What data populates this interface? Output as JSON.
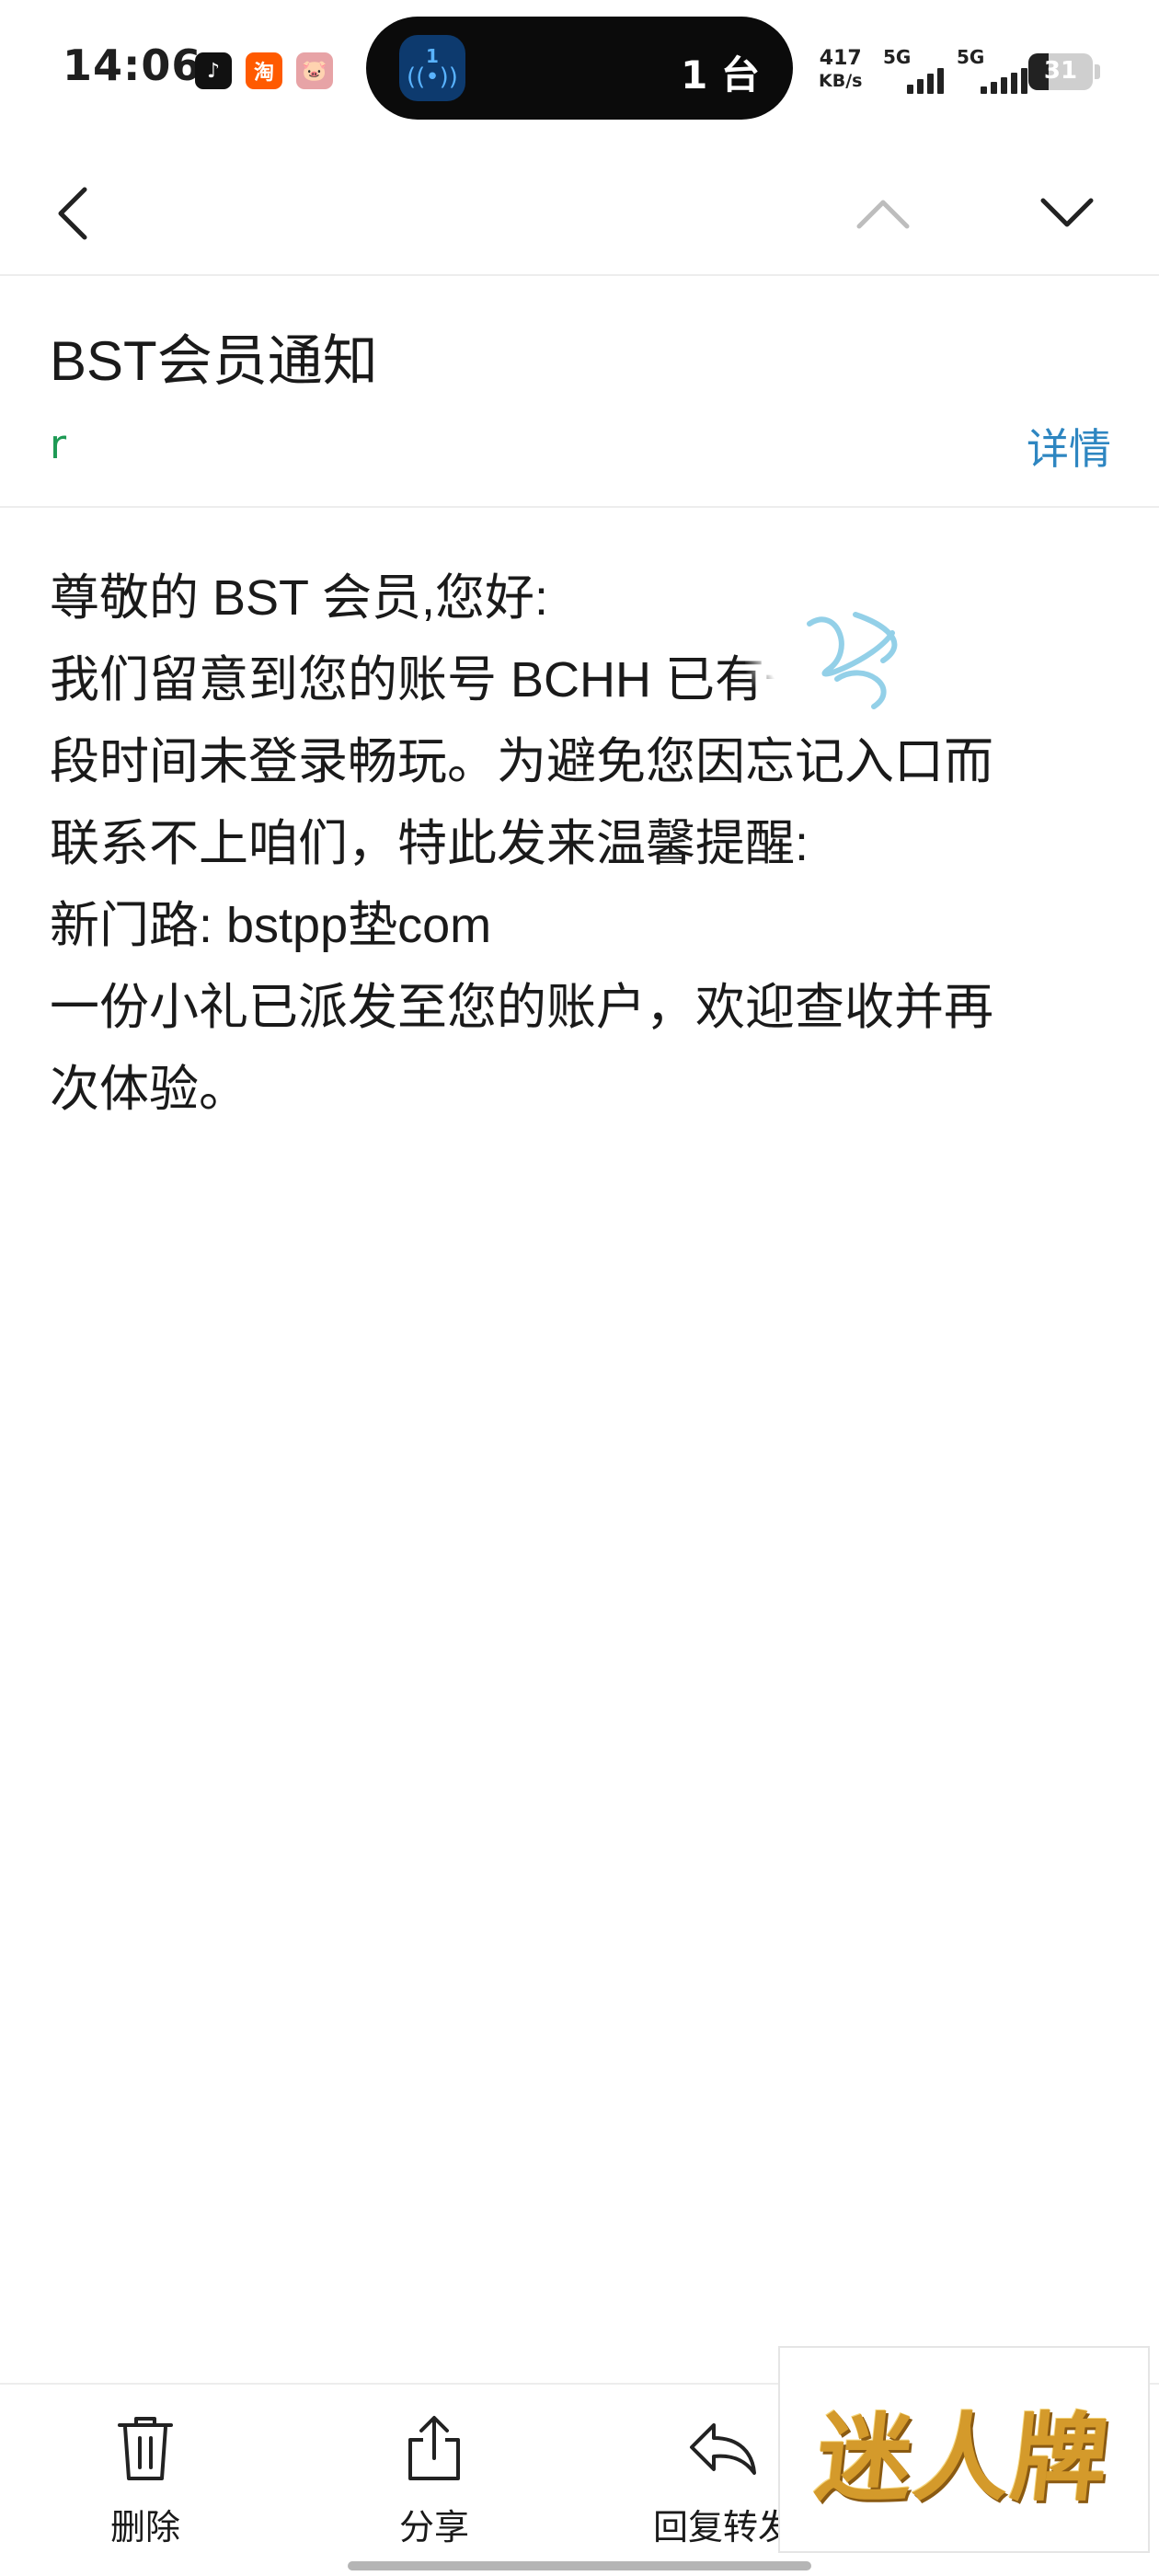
{
  "status_bar": {
    "time": "14:06",
    "apps": [
      {
        "icon": "tiktok-icon",
        "glyph": "♪"
      },
      {
        "icon": "taobao-icon",
        "glyph": "淘"
      },
      {
        "icon": "pig-app-icon",
        "glyph": "🐷"
      }
    ],
    "island": {
      "counter": "1",
      "label": "1 台"
    },
    "net_speed": {
      "value": "417",
      "unit": "KB/s"
    },
    "signal_1": "5G",
    "signal_2": "5G",
    "battery_level": "31",
    "battery_percent": 31
  },
  "toolbar": {
    "back_icon": "chevron-left-icon",
    "prev_icon": "chevron-up-icon",
    "next_icon": "chevron-down-icon"
  },
  "email": {
    "subject": "BST会员通知",
    "sender": "r",
    "details_label": "详情",
    "body_lines": [
      "尊敬的 BST 会员,您好:",
      "我们留意到您的账号 BCHH          已有一",
      "段时间未登录畅玩。为避免您因忘记入口而",
      "联系不上咱们，特此发来温馨提醒:",
      "新门路: bstpp垫com",
      "一份小礼已派发至您的账户，欢迎查收并再",
      "次体验。"
    ]
  },
  "bottom_bar": {
    "delete_label": "删除",
    "share_label": "分享",
    "reply_label": "回复转发"
  },
  "watermark": {
    "text": "迷人牌"
  },
  "colors": {
    "sender": "#1e9a55",
    "link": "#2e86c1",
    "island": "#0b0b0b",
    "watermark_gold": "#d49a2b"
  }
}
